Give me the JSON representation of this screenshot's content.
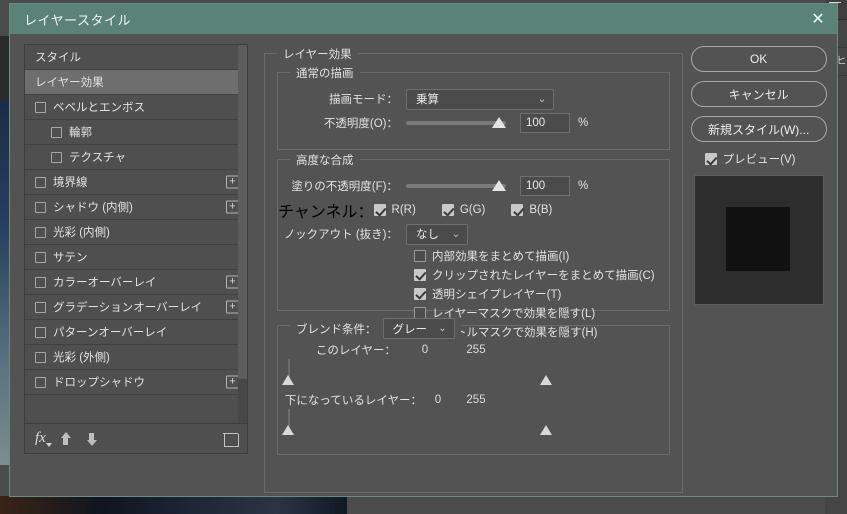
{
  "window": {
    "title": "レイヤースタイル",
    "close_icon": "close-icon",
    "titlebar_color": "#5b8276"
  },
  "styles_panel": {
    "items": [
      {
        "label": "スタイル",
        "type": "header",
        "checkbox": null,
        "selected": false,
        "indent": 0,
        "plus": false
      },
      {
        "label": "レイヤー効果",
        "type": "header",
        "checkbox": null,
        "selected": true,
        "indent": 0,
        "plus": false
      },
      {
        "label": "ベベルとエンボス",
        "type": "effect",
        "checkbox": false,
        "selected": false,
        "indent": 0,
        "plus": false
      },
      {
        "label": "輪郭",
        "type": "effect",
        "checkbox": false,
        "selected": false,
        "indent": 1,
        "plus": false
      },
      {
        "label": "テクスチャ",
        "type": "effect",
        "checkbox": false,
        "selected": false,
        "indent": 1,
        "plus": false
      },
      {
        "label": "境界線",
        "type": "effect",
        "checkbox": false,
        "selected": false,
        "indent": 0,
        "plus": true
      },
      {
        "label": "シャドウ (内側)",
        "type": "effect",
        "checkbox": false,
        "selected": false,
        "indent": 0,
        "plus": true
      },
      {
        "label": "光彩 (内側)",
        "type": "effect",
        "checkbox": false,
        "selected": false,
        "indent": 0,
        "plus": false
      },
      {
        "label": "サテン",
        "type": "effect",
        "checkbox": false,
        "selected": false,
        "indent": 0,
        "plus": false
      },
      {
        "label": "カラーオーバーレイ",
        "type": "effect",
        "checkbox": false,
        "selected": false,
        "indent": 0,
        "plus": true
      },
      {
        "label": "グラデーションオーバーレイ",
        "type": "effect",
        "checkbox": false,
        "selected": false,
        "indent": 0,
        "plus": true
      },
      {
        "label": "パターンオーバーレイ",
        "type": "effect",
        "checkbox": false,
        "selected": false,
        "indent": 0,
        "plus": false
      },
      {
        "label": "光彩 (外側)",
        "type": "effect",
        "checkbox": false,
        "selected": false,
        "indent": 0,
        "plus": false
      },
      {
        "label": "ドロップシャドウ",
        "type": "effect",
        "checkbox": false,
        "selected": false,
        "indent": 0,
        "plus": true
      }
    ],
    "footer": {
      "fx_icon": "fx-icon",
      "move_up_icon": "arrow-up-icon",
      "move_down_icon": "arrow-down-icon",
      "delete_icon": "trash-icon"
    }
  },
  "main": {
    "group_title": "レイヤー効果",
    "normal_blending": {
      "title": "通常の描画",
      "blend_mode_label": "描画モード：",
      "blend_mode_value": "乗算",
      "opacity_label": "不透明度(O)：",
      "opacity_value": "100",
      "opacity_unit": "%",
      "opacity_percent": 100
    },
    "advanced_blending": {
      "title": "高度な合成",
      "fill_opacity_label": "塗りの不透明度(F)：",
      "fill_opacity_value": "100",
      "fill_opacity_unit": "%",
      "fill_opacity_percent": 100,
      "channels_label": "チャンネル：",
      "channels": [
        {
          "label": "R(R)",
          "checked": true
        },
        {
          "label": "G(G)",
          "checked": true
        },
        {
          "label": "B(B)",
          "checked": true
        }
      ],
      "knockout_label": "ノックアウト (抜き)：",
      "knockout_value": "なし",
      "options": [
        {
          "label": "内部効果をまとめて描画(I)",
          "checked": false
        },
        {
          "label": "クリップされたレイヤーをまとめて描画(C)",
          "checked": true
        },
        {
          "label": "透明シェイプレイヤー(T)",
          "checked": true
        },
        {
          "label": "レイヤーマスクで効果を隠す(L)",
          "checked": false
        },
        {
          "label": "ベクトルマスクで効果を隠す(H)",
          "checked": false
        }
      ]
    },
    "blend_conditions": {
      "title_label": "ブレンド条件：",
      "channel_value": "グレー",
      "this_layer": {
        "label": "このレイヤー：",
        "min": "0",
        "max": "255",
        "left_stop_percent": 0,
        "right_stop_percent": 100
      },
      "underlying_layer": {
        "label": "下になっているレイヤー：",
        "min": "0",
        "max": "255",
        "left_stop_percent": 0,
        "right_stop_percent": 100
      }
    }
  },
  "actions": {
    "ok_label": "OK",
    "cancel_label": "キャンセル",
    "new_style_label": "新規スタイル(W)...",
    "preview_label": "プレビュー(V)",
    "preview_checked": true
  },
  "background": {
    "panel_number": "1"
  }
}
